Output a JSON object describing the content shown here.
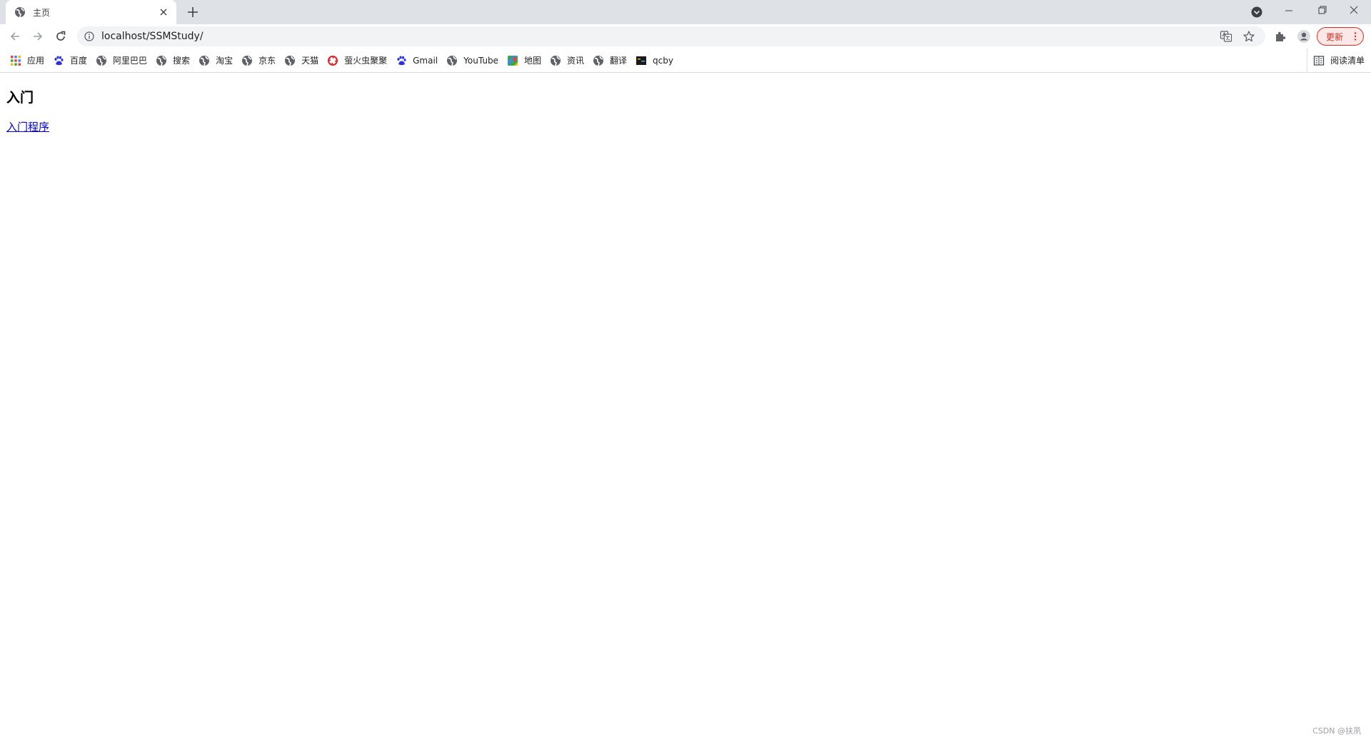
{
  "browser": {
    "tab": {
      "title": "主页",
      "favicon": "globe-icon"
    },
    "url": "localhost/SSMStudy/",
    "update_label": "更新",
    "colors": {
      "tabstrip": "#dee1e6",
      "update_accent": "#d93025",
      "link": "#0000ee"
    }
  },
  "bookmarks": {
    "items": [
      {
        "label": "应用",
        "icon": "apps-grid-icon"
      },
      {
        "label": "百度",
        "icon": "baidu-icon"
      },
      {
        "label": "阿里巴巴",
        "icon": "globe-icon"
      },
      {
        "label": "搜索",
        "icon": "globe-icon"
      },
      {
        "label": "淘宝",
        "icon": "globe-icon"
      },
      {
        "label": "京东",
        "icon": "globe-icon"
      },
      {
        "label": "天猫",
        "icon": "globe-icon"
      },
      {
        "label": "萤火虫聚聚",
        "icon": "huawei-icon"
      },
      {
        "label": "Gmail",
        "icon": "baidu-icon"
      },
      {
        "label": "YouTube",
        "icon": "globe-icon"
      },
      {
        "label": "地图",
        "icon": "maps-icon"
      },
      {
        "label": "资讯",
        "icon": "globe-icon"
      },
      {
        "label": "翻译",
        "icon": "globe-icon"
      },
      {
        "label": "qcby",
        "icon": "qcby-icon"
      }
    ],
    "reading_list": "阅读清单"
  },
  "page": {
    "heading": "入门",
    "link": "入门程序"
  },
  "watermark": "CSDN @扶夙"
}
